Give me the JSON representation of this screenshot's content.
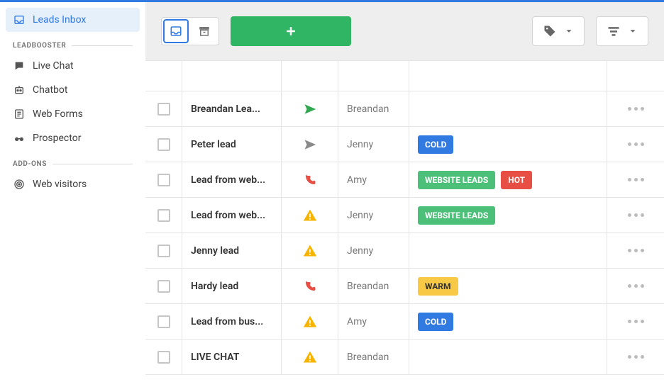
{
  "sidebar": {
    "active_label": "Leads Inbox",
    "sections": [
      {
        "header": "LEADBOOSTER",
        "items": [
          {
            "label": "Live Chat",
            "icon": "chat-icon"
          },
          {
            "label": "Chatbot",
            "icon": "bot-icon"
          },
          {
            "label": "Web Forms",
            "icon": "form-icon"
          },
          {
            "label": "Prospector",
            "icon": "binoculars-icon"
          }
        ]
      },
      {
        "header": "ADD-ONS",
        "items": [
          {
            "label": "Web visitors",
            "icon": "radar-icon"
          }
        ]
      }
    ]
  },
  "toolbar": {
    "view_inbox": "Inbox view",
    "view_archive": "Archive view",
    "add_label": "Add lead",
    "tag_filter": "Label filter",
    "more_filter": "More filter"
  },
  "table": {
    "rows": [
      {
        "title": "Breandan Lea...",
        "activity": "send-green",
        "owner": "Breandan",
        "labels": []
      },
      {
        "title": "Peter lead",
        "activity": "send-gray",
        "owner": "Jenny",
        "labels": [
          "COLD"
        ]
      },
      {
        "title": "Lead from web...",
        "activity": "call-red",
        "owner": "Amy",
        "labels": [
          "WEBSITE LEADS",
          "HOT"
        ]
      },
      {
        "title": "Lead from web...",
        "activity": "warning",
        "owner": "Jenny",
        "labels": [
          "WEBSITE LEADS"
        ]
      },
      {
        "title": "Jenny lead",
        "activity": "warning",
        "owner": "Jenny",
        "labels": []
      },
      {
        "title": "Hardy lead",
        "activity": "call-red",
        "owner": "Breandan",
        "labels": [
          "WARM"
        ]
      },
      {
        "title": "Lead from bus...",
        "activity": "warning",
        "owner": "Amy",
        "labels": [
          "COLD"
        ]
      },
      {
        "title": "LIVE CHAT",
        "activity": "warning",
        "owner": "Breandan",
        "labels": []
      }
    ]
  }
}
